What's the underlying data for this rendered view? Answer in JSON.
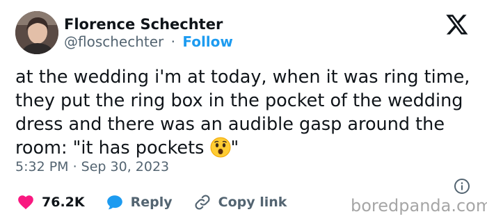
{
  "author": {
    "name": "Florence Schechter",
    "handle": "@floschechter",
    "separator": "·",
    "follow_label": "Follow"
  },
  "tweet": {
    "text": "at the wedding i'm at today, when it was ring time, they put the ring box in the pocket of the wedding dress and there was an audible gasp around the room: \"it has pockets",
    "emoji": "astonished-face-emoji",
    "text_end": "\"",
    "timestamp": "5:32 PM · Sep 30, 2023"
  },
  "actions": {
    "likes": "76.2K",
    "reply_label": "Reply",
    "copy_link_label": "Copy link"
  },
  "watermark": "boredpanda.com",
  "colors": {
    "accent": "#1d9bf0",
    "like": "#f91880",
    "text": "#0f1419",
    "muted": "#536471"
  }
}
